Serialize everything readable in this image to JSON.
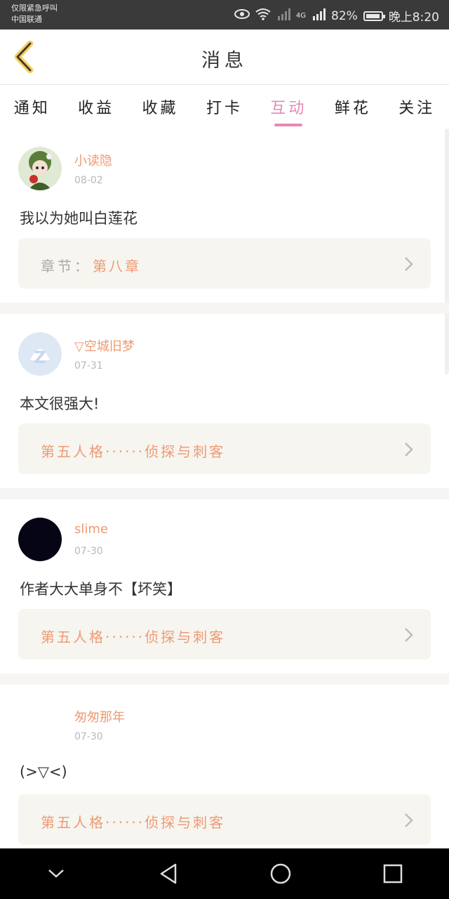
{
  "status_bar": {
    "carrier_line1": "仅限紧急呼叫",
    "carrier_line2": "中国联通",
    "network": "4G",
    "battery": "82%",
    "time": "晚上8:20"
  },
  "header": {
    "title": "消息",
    "back_icon": "chevron-left-icon"
  },
  "tabs": [
    {
      "label": "通知"
    },
    {
      "label": "收益"
    },
    {
      "label": "收藏"
    },
    {
      "label": "打卡"
    },
    {
      "label": "互动",
      "active": true
    },
    {
      "label": "鲜花"
    },
    {
      "label": "关注"
    }
  ],
  "messages": [
    {
      "username": "小读隐",
      "date": "08-02",
      "comment": "我以为她叫白莲花",
      "chapter_label": "章节：",
      "chapter": "第八章",
      "avatar": "anime-avatar"
    },
    {
      "username": "▽空城旧梦",
      "date": "07-31",
      "comment": "本文很强大!",
      "chapter_label": "",
      "chapter": "第五人格······侦探与刺客",
      "avatar": "default-avatar"
    },
    {
      "username": "slime",
      "date": "07-30",
      "comment": "作者大大单身不【坏笑】",
      "chapter_label": "",
      "chapter": "第五人格······侦探与刺客",
      "avatar": "black-avatar"
    },
    {
      "username": "匆匆那年",
      "date": "07-30",
      "comment": "(>▽<)",
      "chapter_label": "",
      "chapter": "第五人格······侦探与刺客",
      "avatar": "blank-avatar"
    }
  ],
  "colors": {
    "accent": "#e58ab3",
    "username": "#ee9a74",
    "back_icon": "#f3d26a"
  }
}
